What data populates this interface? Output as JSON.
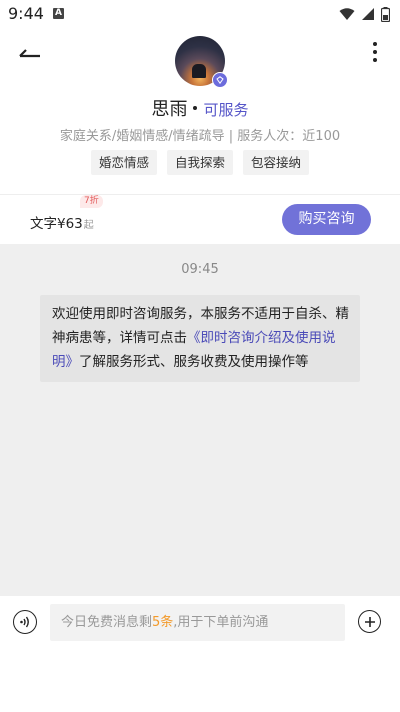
{
  "status_bar": {
    "time": "9:44",
    "notification_icon": "A"
  },
  "header": {
    "counselor_name": "思雨",
    "service_status": "可服务",
    "specialties": "家庭关系/婚姻情感/情绪疏导 | 服务人次：近100",
    "chips": [
      "婚恋情感",
      "自我探索",
      "包容接纳"
    ]
  },
  "pricing": {
    "label": "文字¥63",
    "suffix": "起",
    "discount": "7折",
    "buy_button": "购买咨询",
    "accent_color": "#7172d8"
  },
  "chat": {
    "timestamp": "09:45",
    "message_before_link": "欢迎使用即时咨询服务，本服务不适用于自杀、精神病患等，详情可点击",
    "message_link": "《即时咨询介绍及使用说明》",
    "message_after_link": "了解服务形式、服务收费及使用操作等"
  },
  "input": {
    "placeholder_prefix": "今日免费消息剩",
    "placeholder_count": "5条",
    "placeholder_suffix": ",用于下单前沟通"
  },
  "icons": [
    "back-arrow-icon",
    "more-vertical-icon",
    "verified-icon",
    "voice-icon",
    "plus-icon",
    "wifi-icon",
    "signal-icon",
    "battery-icon"
  ]
}
